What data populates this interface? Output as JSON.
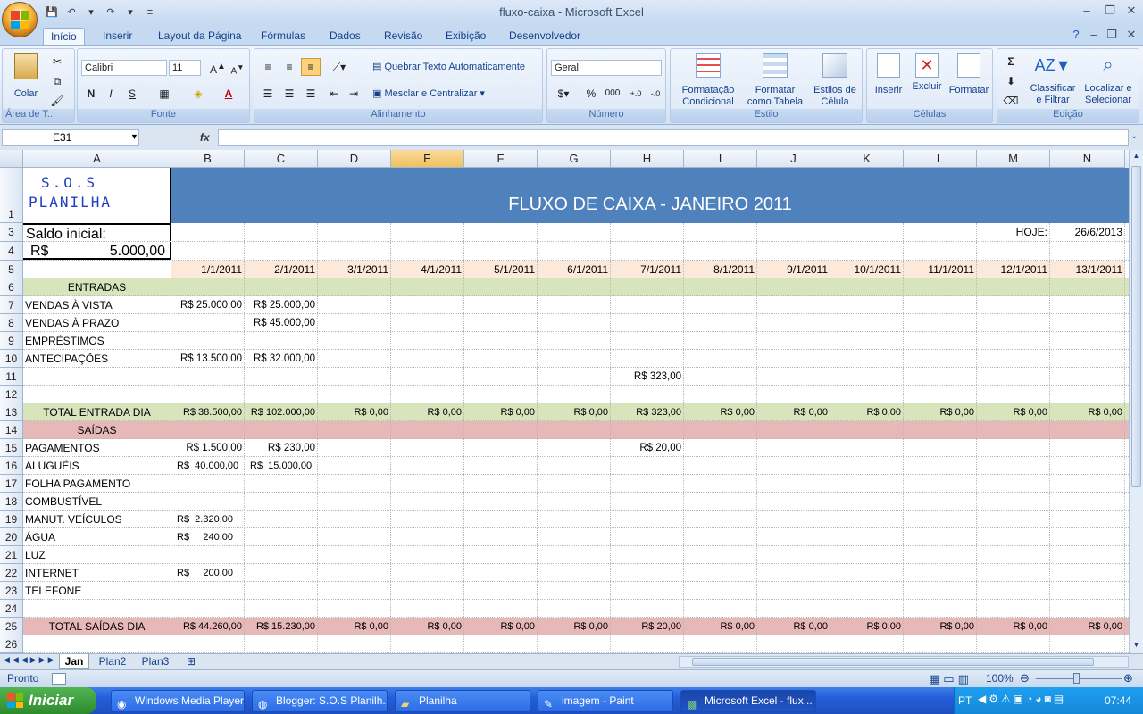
{
  "window": {
    "title": "fluxo-caixa - Microsoft Excel"
  },
  "ribbon_tabs": [
    "Início",
    "Inserir",
    "Layout da Página",
    "Fórmulas",
    "Dados",
    "Revisão",
    "Exibição",
    "Desenvolvedor"
  ],
  "ribbon": {
    "clipboard": {
      "paste": "Colar",
      "label": "Área de T..."
    },
    "font": {
      "name": "Calibri",
      "size": "11",
      "label": "Fonte",
      "bold": "N",
      "italic": "I",
      "underline": "S",
      "color_btn": "A"
    },
    "alignment": {
      "wrap": "Quebrar Texto Automaticamente",
      "merge": "Mesclar e Centralizar",
      "label": "Alinhamento"
    },
    "number": {
      "format": "Geral",
      "label": "Número",
      "percent": "%",
      "thousands": "000"
    },
    "style": {
      "cond1": "Formatação",
      "cond2": "Condicional",
      "table1": "Formatar",
      "table2": "como Tabela",
      "cell1": "Estilos de",
      "cell2": "Célula",
      "label": "Estilo"
    },
    "cells": {
      "insert": "Inserir",
      "delete": "Excluir",
      "format": "Formatar",
      "label": "Células"
    },
    "editing": {
      "sort1": "Classificar",
      "sort2": "e Filtrar",
      "find1": "Localizar e",
      "find2": "Selecionar",
      "label": "Edição"
    }
  },
  "formula_bar": {
    "name_box": "E31",
    "fx": "fx",
    "formula": ""
  },
  "columns": [
    "A",
    "B",
    "C",
    "D",
    "E",
    "F",
    "G",
    "H",
    "I",
    "J",
    "K",
    "L",
    "M",
    "N"
  ],
  "selected_column": "E",
  "sheet": {
    "logo_line1": "S.O.S",
    "logo_line2": "PLANILHA",
    "title": "FLUXO DE CAIXA - JANEIRO 2011",
    "saldo_label": "Saldo inicial:",
    "saldo_currency": "R$",
    "saldo_value": "5.000,00",
    "today_label": "HOJE:",
    "today_value": "26/6/2013",
    "dates": [
      "1/1/2011",
      "2/1/2011",
      "3/1/2011",
      "4/1/2011",
      "5/1/2011",
      "6/1/2011",
      "7/1/2011",
      "8/1/2011",
      "9/1/2011",
      "10/1/2011",
      "11/1/2011",
      "12/1/2011",
      "13/1/2011"
    ],
    "entradas_header": "ENTRADAS",
    "saidas_header": "SAÍDAS",
    "rows": [
      {
        "num": "7",
        "label": "VENDAS À VISTA",
        "cells": {
          "B": "R$ 25.000,00",
          "C": "R$ 25.000,00"
        }
      },
      {
        "num": "8",
        "label": "VENDAS À PRAZO",
        "cells": {
          "C": "R$ 45.000,00"
        }
      },
      {
        "num": "9",
        "label": "EMPRÉSTIMOS",
        "cells": {}
      },
      {
        "num": "10",
        "label": "ANTECIPAÇÕES",
        "cells": {
          "B": "R$ 13.500,00",
          "C": "R$ 32.000,00"
        }
      },
      {
        "num": "11",
        "label": "",
        "cells": {
          "H": "R$ 323,00"
        }
      },
      {
        "num": "12",
        "label": "",
        "cells": {}
      }
    ],
    "total_entrada": {
      "label": "TOTAL ENTRADA DIA",
      "values": [
        "R$ 38.500,00",
        "R$ 102.000,00",
        "R$ 0,00",
        "R$ 0,00",
        "R$ 0,00",
        "R$ 0,00",
        "R$ 323,00",
        "R$ 0,00",
        "R$ 0,00",
        "R$ 0,00",
        "R$ 0,00",
        "R$ 0,00",
        "R$ 0,00"
      ]
    },
    "saida_rows": [
      {
        "num": "15",
        "label": "PAGAMENTOS",
        "cells": {
          "B": "R$ 1.500,00",
          "C": "R$ 230,00",
          "H": "R$ 20,00"
        }
      },
      {
        "num": "16",
        "label": "ALUGUÉIS",
        "cells": {
          "B": "R$  40.000,00",
          "C": "R$  15.000,00"
        }
      },
      {
        "num": "17",
        "label": "FOLHA PAGAMENTO",
        "cells": {}
      },
      {
        "num": "18",
        "label": "COMBUSTÍVEL",
        "cells": {}
      },
      {
        "num": "19",
        "label": "MANUT. VEÍCULOS",
        "cells": {
          "B": "R$  2.320,00"
        }
      },
      {
        "num": "20",
        "label": "ÁGUA",
        "cells": {
          "B": "R$     240,00"
        }
      },
      {
        "num": "21",
        "label": "LUZ",
        "cells": {}
      },
      {
        "num": "22",
        "label": "INTERNET",
        "cells": {
          "B": "R$     200,00"
        }
      },
      {
        "num": "23",
        "label": "TELEFONE",
        "cells": {}
      },
      {
        "num": "24",
        "label": "",
        "cells": {}
      }
    ],
    "total_saidas": {
      "label": "TOTAL SAÍDAS DIA",
      "values": [
        "R$ 44.260,00",
        "R$ 15.230,00",
        "R$ 0,00",
        "R$ 0,00",
        "R$ 0,00",
        "R$ 0,00",
        "R$ 20,00",
        "R$ 0,00",
        "R$ 0,00",
        "R$ 0,00",
        "R$ 0,00",
        "R$ 0,00",
        "R$ 0,00"
      ]
    }
  },
  "row_numbers_static": {
    "r1": "1",
    "r3": "3",
    "r4": "4",
    "r5": "5",
    "r6": "6",
    "r13": "13",
    "r14": "14",
    "r25": "25",
    "r26": "26"
  },
  "sheet_tabs": [
    "Jan",
    "Plan2",
    "Plan3"
  ],
  "active_sheet": "Jan",
  "status": {
    "text": "Pronto",
    "zoom": "100%"
  },
  "taskbar": {
    "start": "Iniciar",
    "tasks": [
      "Windows Media Player",
      "Blogger: S.O.S Planilh...",
      "Planilha",
      "imagem - Paint",
      "Microsoft Excel - flux..."
    ],
    "lang": "PT",
    "clock": "07:44"
  },
  "colors": {
    "title_band": "#4f81bd",
    "entradas": "#d7e4bc",
    "saidas": "#e6b9b8",
    "dates": "#fde9d9",
    "logo": "#1f3fbf"
  }
}
